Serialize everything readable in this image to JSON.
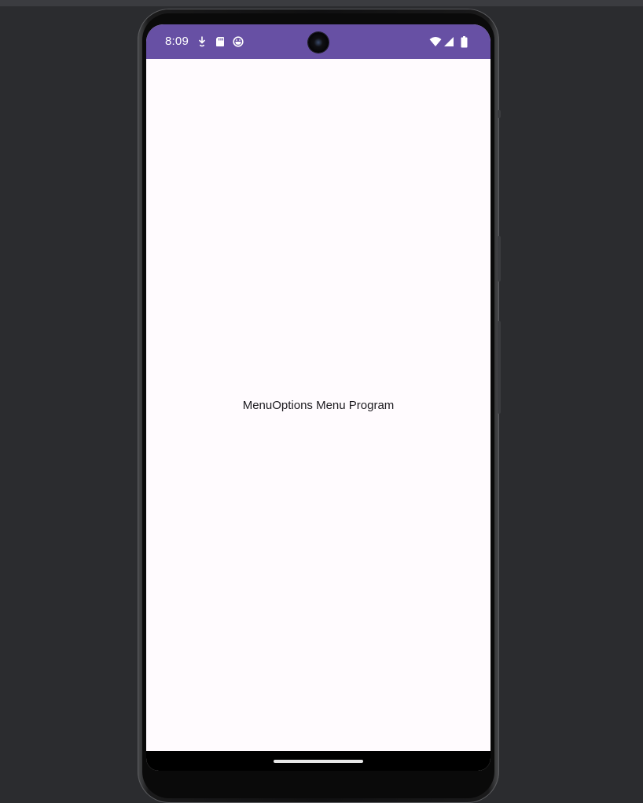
{
  "status_bar": {
    "time": "8:09",
    "background_color": "#6750a4",
    "left_icons": [
      "download-icon",
      "sd-card-icon",
      "app-notification-icon"
    ],
    "right_icons": [
      "wifi-icon",
      "cellular-signal-icon",
      "battery-icon"
    ]
  },
  "main": {
    "center_text": "MenuOptions Menu Program",
    "background_color": "#fffbfe"
  },
  "nav_bar": {
    "indicator": "home-indicator"
  }
}
